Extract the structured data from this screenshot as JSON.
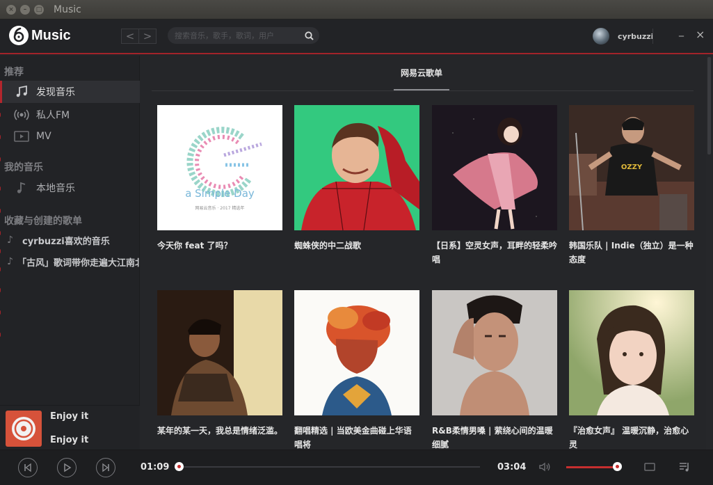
{
  "window": {
    "title": "Music"
  },
  "header": {
    "logo_text": "Music",
    "back": "<",
    "forward": ">",
    "search_placeholder": "搜索音乐，歌手，歌词，用户",
    "username": "cyrbuzzi",
    "minimize": "_",
    "close": "×"
  },
  "sidebar": {
    "recommend_title": "推荐",
    "recommend_items": [
      {
        "label": "发现音乐",
        "icon": "music-note-icon",
        "active": true
      },
      {
        "label": "私人FM",
        "icon": "radio-icon",
        "active": false
      },
      {
        "label": "MV",
        "icon": "video-icon",
        "active": false
      }
    ],
    "my_music_title": "我的音乐",
    "my_music_items": [
      {
        "label": "本地音乐",
        "icon": "music-note-icon"
      }
    ],
    "playlists_title": "收藏与创建的歌单",
    "playlists": [
      {
        "label": "cyrbuzzi喜欢的音乐",
        "icon": "music-note-icon"
      },
      {
        "label": "「古风」歌词带你走遍大江南北",
        "icon": "music-note-icon"
      }
    ]
  },
  "now_playing": {
    "title": "Enjoy it",
    "artist": "Enjoy it"
  },
  "main": {
    "tab": "网易云歌单",
    "cards": [
      {
        "title": "今天你 feat 了吗？",
        "cover_text": "a Simple Day",
        "cover_sub": "网易云音乐 · 2017 精选年"
      },
      {
        "title": "蜘蛛侠的中二战歌"
      },
      {
        "title": "【日系】空灵女声，耳畔的轻柔吟唱"
      },
      {
        "title": "韩国乐队 | Indie（独立）是一种态度"
      },
      {
        "title": "某年的某一天，我总是情绪泛滥。"
      },
      {
        "title": "翻唱精选 | 当欧美金曲碰上华语唱将"
      },
      {
        "title": "R&B柔情男嗓 | 萦绕心间的温暖细腻"
      },
      {
        "title": "『治愈女声』 温暖沉静，治愈心灵"
      }
    ]
  },
  "player": {
    "current_time": "01:09",
    "total_time": "03:04",
    "progress": 0.0,
    "volume": 1.0
  },
  "colors": {
    "accent": "#c62f2f",
    "header_rule": "#a3232a",
    "background": "#252629",
    "sidebar": "#222326"
  }
}
